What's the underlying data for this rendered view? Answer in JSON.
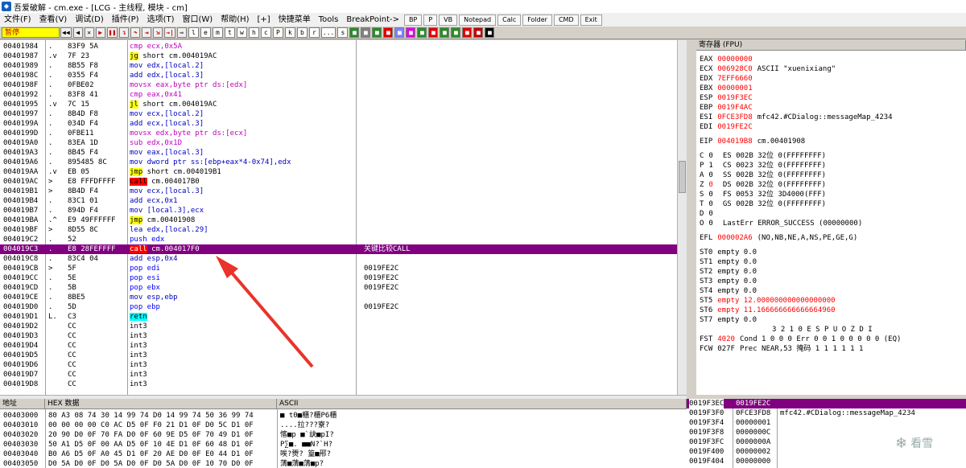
{
  "title": "吾爱破解 - cm.exe - [LCG - 主线程, 模块 - cm]",
  "menu": {
    "items": [
      "文件(F)",
      "查看(V)",
      "调试(D)",
      "插件(P)",
      "选项(T)",
      "窗口(W)",
      "帮助(H)",
      "[+]",
      "快捷菜单",
      "Tools",
      "BreakPoint->"
    ],
    "plugin_buttons": [
      "BP",
      "P",
      "VB",
      "Notepad",
      "Calc",
      "Folder",
      "CMD",
      "Exit"
    ]
  },
  "toolbar": {
    "status": "暂停",
    "letters": [
      "l",
      "e",
      "m",
      "t",
      "w",
      "h",
      "c",
      "P",
      "k",
      "b",
      "r",
      "...",
      "s"
    ]
  },
  "disasm": {
    "rows": [
      {
        "addr": "00401984",
        "mark": ".",
        "hex": "83F9 5A",
        "asm": [
          [
            "",
            "cmp ecx,0x5A"
          ]
        ]
      },
      {
        "addr": "00401987",
        "mark": ".v",
        "hex": "7F 23",
        "asm": [
          [
            "jg",
            "jg"
          ],
          [
            "",
            " short cm.004019AC"
          ]
        ]
      },
      {
        "addr": "00401989",
        "mark": ".",
        "hex": "8B55 F8",
        "asm": [
          [
            "",
            "mov edx,[local.2]"
          ]
        ]
      },
      {
        "addr": "0040198C",
        "mark": ".",
        "hex": "0355 F4",
        "asm": [
          [
            "",
            "add edx,[local.3]"
          ]
        ]
      },
      {
        "addr": "0040198F",
        "mark": ".",
        "hex": "0FBE02",
        "asm": [
          [
            "",
            "movsx eax,byte ptr ds:[edx]"
          ]
        ]
      },
      {
        "addr": "00401992",
        "mark": ".",
        "hex": "83F8 41",
        "asm": [
          [
            "",
            "cmp eax,0x41"
          ]
        ]
      },
      {
        "addr": "00401995",
        "mark": ".v",
        "hex": "7C 15",
        "asm": [
          [
            "jl",
            "jl"
          ],
          [
            "",
            " short cm.004019AC"
          ]
        ]
      },
      {
        "addr": "00401997",
        "mark": ".",
        "hex": "8B4D F8",
        "asm": [
          [
            "",
            "mov ecx,[local.2]"
          ]
        ]
      },
      {
        "addr": "0040199A",
        "mark": ".",
        "hex": "034D F4",
        "asm": [
          [
            "",
            "add ecx,[local.3]"
          ]
        ]
      },
      {
        "addr": "0040199D",
        "mark": ".",
        "hex": "0FBE11",
        "asm": [
          [
            "",
            "movsx edx,byte ptr ds:[ecx]"
          ]
        ]
      },
      {
        "addr": "004019A0",
        "mark": ".",
        "hex": "83EA 1D",
        "asm": [
          [
            "",
            "sub edx,0x1D"
          ]
        ]
      },
      {
        "addr": "004019A3",
        "mark": ".",
        "hex": "8B45 F4",
        "asm": [
          [
            "",
            "mov eax,[local.3]"
          ]
        ]
      },
      {
        "addr": "004019A6",
        "mark": ".",
        "hex": "895485 8C",
        "asm": [
          [
            "",
            "mov dword ptr ss:[ebp+eax*4-0x74],edx"
          ]
        ]
      },
      {
        "addr": "004019AA",
        "mark": ".v",
        "hex": "EB 05",
        "asm": [
          [
            "jmp",
            "jmp"
          ],
          [
            "",
            " short cm.004019B1"
          ]
        ]
      },
      {
        "addr": "004019AC",
        "mark": ">",
        "hex": "E8 FFFDFFFF",
        "asm": [
          [
            "call",
            "call"
          ],
          [
            "",
            " cm.004017B0"
          ]
        ]
      },
      {
        "addr": "004019B1",
        "mark": ">",
        "hex": "8B4D F4",
        "asm": [
          [
            "",
            "mov ecx,[local.3]"
          ]
        ]
      },
      {
        "addr": "004019B4",
        "mark": ".",
        "hex": "83C1 01",
        "asm": [
          [
            "",
            "add ecx,0x1"
          ]
        ]
      },
      {
        "addr": "004019B7",
        "mark": ".",
        "hex": "894D F4",
        "asm": [
          [
            "",
            "mov [local.3],ecx"
          ]
        ]
      },
      {
        "addr": "004019BA",
        "mark": ".^",
        "hex": "E9 49FFFFFF",
        "asm": [
          [
            "jmp",
            "jmp"
          ],
          [
            "",
            " cm.00401908"
          ]
        ]
      },
      {
        "addr": "004019BF",
        "mark": ">",
        "hex": "8D55 8C",
        "asm": [
          [
            "",
            "lea edx,[local.29]"
          ]
        ]
      },
      {
        "addr": "004019C2",
        "mark": ".",
        "hex": "52",
        "asm": [
          [
            "push",
            "push edx"
          ]
        ]
      },
      {
        "addr": "004019C3",
        "mark": ".",
        "hex": "E8 28FEFFFF",
        "asm": [
          [
            "call",
            "call"
          ],
          [
            "",
            " cm.004017F0"
          ]
        ],
        "sel": true,
        "comment": "关键比较CALL"
      },
      {
        "addr": "004019C8",
        "mark": ".",
        "hex": "83C4 04",
        "asm": [
          [
            "",
            "add esp,0x4"
          ]
        ]
      },
      {
        "addr": "004019CB",
        "mark": ">",
        "hex": "5F",
        "asm": [
          [
            "pop",
            "pop edi"
          ]
        ],
        "comment": "0019FE2C"
      },
      {
        "addr": "004019CC",
        "mark": ".",
        "hex": "5E",
        "asm": [
          [
            "pop",
            "pop esi"
          ]
        ],
        "comment": "0019FE2C"
      },
      {
        "addr": "004019CD",
        "mark": ".",
        "hex": "5B",
        "asm": [
          [
            "pop",
            "pop ebx"
          ]
        ],
        "comment": "0019FE2C"
      },
      {
        "addr": "004019CE",
        "mark": ".",
        "hex": "8BE5",
        "asm": [
          [
            "",
            "mov esp,ebp"
          ]
        ]
      },
      {
        "addr": "004019D0",
        "mark": ".",
        "hex": "5D",
        "asm": [
          [
            "pop",
            "pop ebp"
          ]
        ],
        "comment": "0019FE2C"
      },
      {
        "addr": "004019D1",
        "mark": "L.",
        "hex": "C3",
        "asm": [
          [
            "retn",
            "retn"
          ]
        ]
      },
      {
        "addr": "004019D2",
        "mark": "",
        "hex": "CC",
        "asm": [
          [
            "",
            "int3"
          ]
        ]
      },
      {
        "addr": "004019D3",
        "mark": "",
        "hex": "CC",
        "asm": [
          [
            "",
            "int3"
          ]
        ]
      },
      {
        "addr": "004019D4",
        "mark": "",
        "hex": "CC",
        "asm": [
          [
            "",
            "int3"
          ]
        ]
      },
      {
        "addr": "004019D5",
        "mark": "",
        "hex": "CC",
        "asm": [
          [
            "",
            "int3"
          ]
        ]
      },
      {
        "addr": "004019D6",
        "mark": "",
        "hex": "CC",
        "asm": [
          [
            "",
            "int3"
          ]
        ]
      },
      {
        "addr": "004019D7",
        "mark": "",
        "hex": "CC",
        "asm": [
          [
            "",
            "int3"
          ]
        ]
      },
      {
        "addr": "004019D8",
        "mark": "",
        "hex": "CC",
        "asm": [
          [
            "",
            "int3"
          ]
        ]
      }
    ]
  },
  "registers": {
    "header": "寄存器 (FPU)",
    "gpr": [
      {
        "name": "EAX",
        "value": "00000000",
        "red": true,
        "note": ""
      },
      {
        "name": "ECX",
        "value": "006928C0",
        "red": true,
        "note": "ASCII \"xuenixiang\""
      },
      {
        "name": "EDX",
        "value": "7EFF6660",
        "red": true,
        "note": ""
      },
      {
        "name": "EBX",
        "value": "00000001",
        "red": true,
        "note": ""
      },
      {
        "name": "ESP",
        "value": "0019F3EC",
        "red": true,
        "note": ""
      },
      {
        "name": "EBP",
        "value": "0019F4AC",
        "red": true,
        "note": ""
      },
      {
        "name": "ESI",
        "value": "0FCE3FD8",
        "red": true,
        "note": "mfc42.#CDialog::messageMap_4234"
      },
      {
        "name": "EDI",
        "value": "0019FE2C",
        "red": true,
        "note": ""
      }
    ],
    "eip": {
      "name": "EIP",
      "value": "004019B8",
      "note": "cm.00401908"
    },
    "flags": [
      {
        "flag": "C",
        "v": "0",
        "seg": "ES 002B 32位 0(FFFFFFFF)"
      },
      {
        "flag": "P",
        "v": "1",
        "seg": "CS 0023 32位 0(FFFFFFFF)"
      },
      {
        "flag": "A",
        "v": "0",
        "seg": "SS 002B 32位 0(FFFFFFFF)"
      },
      {
        "flag": "Z",
        "v": "0",
        "seg": "DS 002B 32位 0(FFFFFFFF)"
      },
      {
        "flag": "S",
        "v": "0",
        "seg": "FS 0053 32位 3D4000(FFF)"
      },
      {
        "flag": "T",
        "v": "0",
        "seg": "GS 002B 32位 0(FFFFFFFF)"
      },
      {
        "flag": "D",
        "v": "0",
        "seg": ""
      },
      {
        "flag": "O",
        "v": "0",
        "seg": "LastErr ERROR_SUCCESS (00000000)"
      }
    ],
    "efl": {
      "name": "EFL",
      "value": "000002A6",
      "note": "(NO,NB,NE,A,NS,PE,GE,G)"
    },
    "fpu": [
      {
        "name": "ST0",
        "v": "empty 0.0",
        "red": false
      },
      {
        "name": "ST1",
        "v": "empty 0.0",
        "red": false
      },
      {
        "name": "ST2",
        "v": "empty 0.0",
        "red": false
      },
      {
        "name": "ST3",
        "v": "empty 0.0",
        "red": false
      },
      {
        "name": "ST4",
        "v": "empty 0.0",
        "red": false
      },
      {
        "name": "ST5",
        "v": "empty 12.000000000000000000",
        "red": true
      },
      {
        "name": "ST6",
        "v": "empty 11.166666666666664960",
        "red": true
      },
      {
        "name": "ST7",
        "v": "empty 0.0",
        "red": false
      }
    ],
    "fpu_bits_header": "3 2 1 0      E S P U O Z D I",
    "fst": {
      "name": "FST",
      "value": "4020",
      "rest": "Cond 1 0 0 0  Err 0 0 1 0 0 0 0 0  (EQ)"
    },
    "fcw": {
      "name": "FCW",
      "value": "027F",
      "rest": "Prec NEAR,53  掩码    1 1 1 1 1 1"
    }
  },
  "dump": {
    "headers": [
      "地址",
      "HEX 数据",
      "ASCII"
    ],
    "rows": [
      {
        "addr": "00403000",
        "hex": "80 A3 08 74 30 14 99 74 D0 14 99 74 50 36 99 74",
        "ascii": "■  t0■櫃?櫃P6櫃"
      },
      {
        "addr": "00403010",
        "hex": "00 00 00 00 C0 AC D5 0F F0 21 D1 0F D0 5C D1 0F",
        "ascii": "....拉???寮?"
      },
      {
        "addr": "00403020",
        "hex": "20 90 D0 0F 70 FA D0 0F 60 9E D5 0F 70 49 D1 0F",
        "ascii": " 愘■p  ■`訣■pI?"
      },
      {
        "addr": "00403030",
        "hex": "50 A1 D5 0F 00 AA D5 0F 10 4E D1 0F 60 48 D1 0F",
        "ascii": "P∑■. ■■N?`H?"
      },
      {
        "addr": "00403040",
        "hex": "B0 A6 D5 0F A0 45 D1 0F 20 AE D0 0F E0 44 D1 0F",
        "ascii": "唉?燛? 篁■郉?"
      },
      {
        "addr": "00403050",
        "hex": "D0 5A D0 0F D0 5A D0 0F D0 5A D0 0F 10 70 D0 0F",
        "ascii": "蔳■蔳■蔳■p?"
      }
    ]
  },
  "stack": {
    "header_addr": "0019F3EC",
    "header_val": "0019FE2C",
    "rows": [
      {
        "addr": "0019F3F0",
        "val": "0FCE3FD8",
        "note": "mfc42.#CDialog::messageMap_4234"
      },
      {
        "addr": "0019F3F4",
        "val": "00000001",
        "note": ""
      },
      {
        "addr": "0019F3F8",
        "val": "0000000C",
        "note": ""
      },
      {
        "addr": "0019F3FC",
        "val": "0000000A",
        "note": ""
      },
      {
        "addr": "0019F400",
        "val": "00000002",
        "note": ""
      },
      {
        "addr": "0019F404",
        "val": "00000000",
        "note": ""
      }
    ]
  },
  "watermark": "看雪",
  "colors": {
    "selected_row": "#800080",
    "call_bg": "#ff0000",
    "jmp_bg": "#ffff00",
    "push_pop": "#0000ff",
    "retn_bg": "#00ffff"
  }
}
